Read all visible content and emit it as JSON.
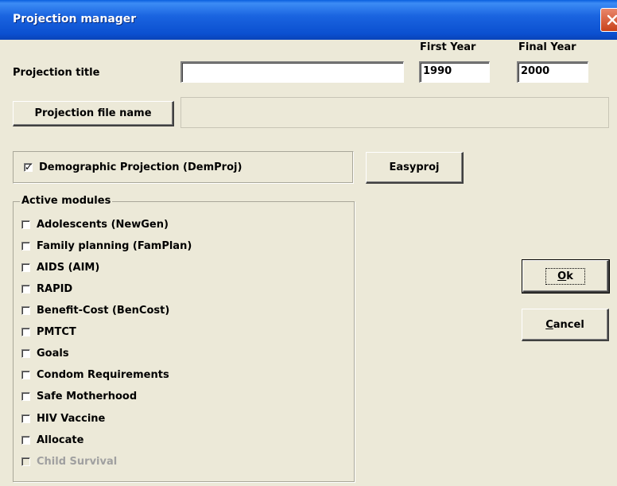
{
  "window": {
    "title": "Projection manager"
  },
  "fields": {
    "projection_title_label": "Projection title",
    "projection_title_value": "",
    "first_year_label": "First Year",
    "first_year_value": "1990",
    "final_year_label": "Final Year",
    "final_year_value": "2000"
  },
  "buttons": {
    "projection_file_name": "Projection file name",
    "easyproj": "Easyproj",
    "ok": "Ok",
    "cancel": "Cancel"
  },
  "demproj": {
    "label": "Demographic Projection (DemProj)",
    "checked": true
  },
  "modules": {
    "group_label": "Active modules",
    "items": [
      {
        "label": "Adolescents (NewGen)",
        "checked": false,
        "enabled": true
      },
      {
        "label": "Family planning (FamPlan)",
        "checked": false,
        "enabled": true
      },
      {
        "label": "AIDS (AIM)",
        "checked": false,
        "enabled": true
      },
      {
        "label": "RAPID",
        "checked": false,
        "enabled": true
      },
      {
        "label": "Benefit-Cost (BenCost)",
        "checked": false,
        "enabled": true
      },
      {
        "label": "PMTCT",
        "checked": false,
        "enabled": true
      },
      {
        "label": "Goals",
        "checked": false,
        "enabled": true
      },
      {
        "label": "Condom Requirements",
        "checked": false,
        "enabled": true
      },
      {
        "label": "Safe Motherhood",
        "checked": false,
        "enabled": true
      },
      {
        "label": "HIV Vaccine",
        "checked": false,
        "enabled": true
      },
      {
        "label": "Allocate",
        "checked": false,
        "enabled": true
      },
      {
        "label": "Child Survival",
        "checked": false,
        "enabled": false
      }
    ]
  }
}
